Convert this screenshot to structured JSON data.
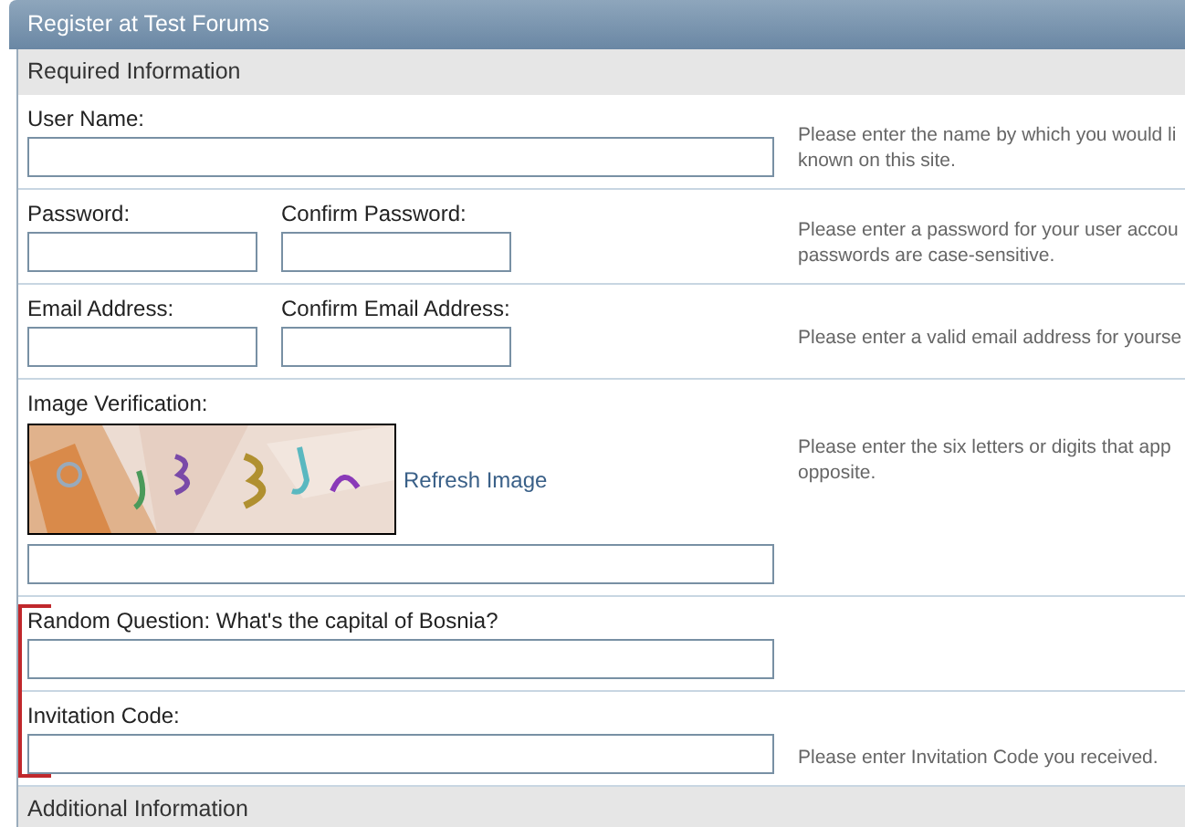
{
  "header": {
    "title": "Register at Test Forums"
  },
  "required_section": {
    "heading": "Required Information"
  },
  "rows": [
    {
      "kind": "single",
      "label": "User Name:",
      "help": [
        "Please enter the name by which you would li",
        "known on this site."
      ]
    },
    {
      "kind": "pair",
      "fields": [
        {
          "label": "Password:"
        },
        {
          "label": "Confirm Password:"
        }
      ],
      "help": [
        "Please enter a password for your user accou",
        "passwords are case-sensitive."
      ]
    },
    {
      "kind": "pair",
      "fields": [
        {
          "label": "Email Address:"
        },
        {
          "label": "Confirm Email Address:"
        }
      ],
      "help": [
        "Please enter a valid email address for yourse"
      ]
    },
    {
      "kind": "captcha",
      "label": "Image Verification:",
      "link": "Refresh Image",
      "help": [
        "Please enter the six letters or digits that app",
        "opposite."
      ]
    }
  ],
  "marked_rows": [
    {
      "kind": "single",
      "label": "Random Question: What's the capital of Bosnia?"
    },
    {
      "kind": "single",
      "label": "Invitation Code:",
      "help": [
        "Please enter Invitation Code you received."
      ]
    }
  ],
  "additional_section": {
    "heading": "Additional Information"
  }
}
